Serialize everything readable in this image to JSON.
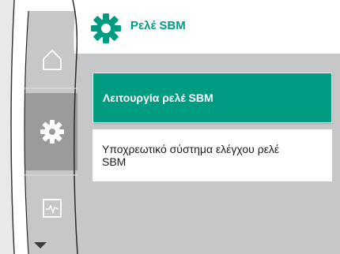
{
  "header": {
    "title": "Ρελέ SBM",
    "icon": "gear-icon"
  },
  "sidebar": {
    "items": [
      {
        "icon": "home-icon",
        "selected": false
      },
      {
        "icon": "gear-icon",
        "selected": true
      },
      {
        "icon": "monitor-icon",
        "selected": false
      }
    ],
    "scroll_icon": "chevron-down-icon"
  },
  "menu": {
    "items": [
      {
        "label": "Λειτουργία ρελέ SBM",
        "selected": true
      },
      {
        "label": "Υποχρεωτικό σύστημα ελέγχου ρελέ SBM",
        "selected": false
      }
    ]
  },
  "colors": {
    "accent": "#009c82",
    "rail_bg": "#c6c7c8",
    "rail_selected": "#9a9b9c",
    "content_bg": "#c6c7c8"
  }
}
